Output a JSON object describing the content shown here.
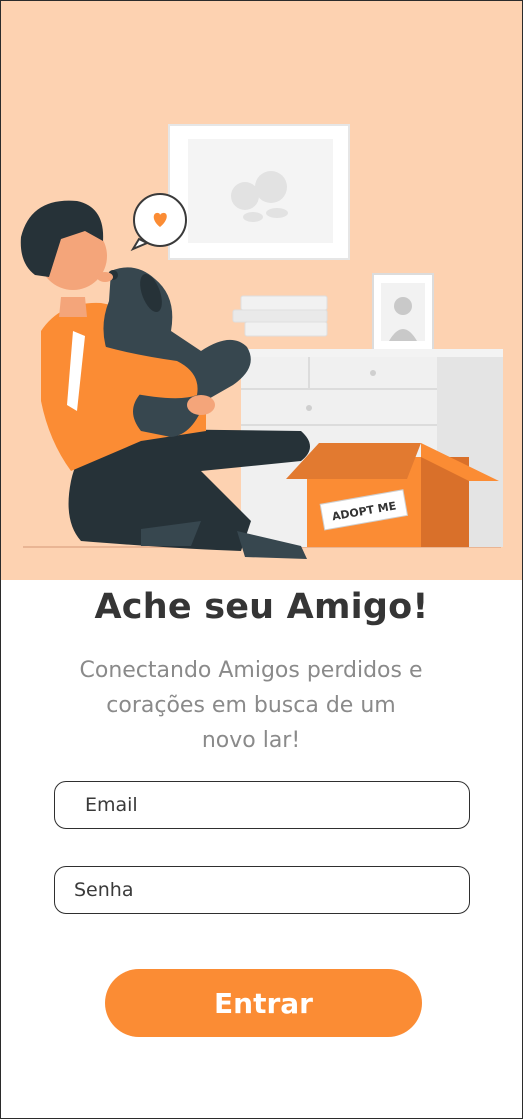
{
  "hero": {
    "box_label": "ADOPT ME"
  },
  "title": "Ache seu Amigo!",
  "subtitle": {
    "line1": "Conectando Amigos perdidos e",
    "line2": "corações em busca de um",
    "line3": "novo lar!"
  },
  "form": {
    "email_placeholder": "Email",
    "password_placeholder": "Senha",
    "submit_label": "Entrar"
  },
  "colors": {
    "hero_background": "#fdd2b1",
    "accent": "#fb8c34",
    "title": "#353535",
    "subtitle": "#8a8a8a"
  }
}
